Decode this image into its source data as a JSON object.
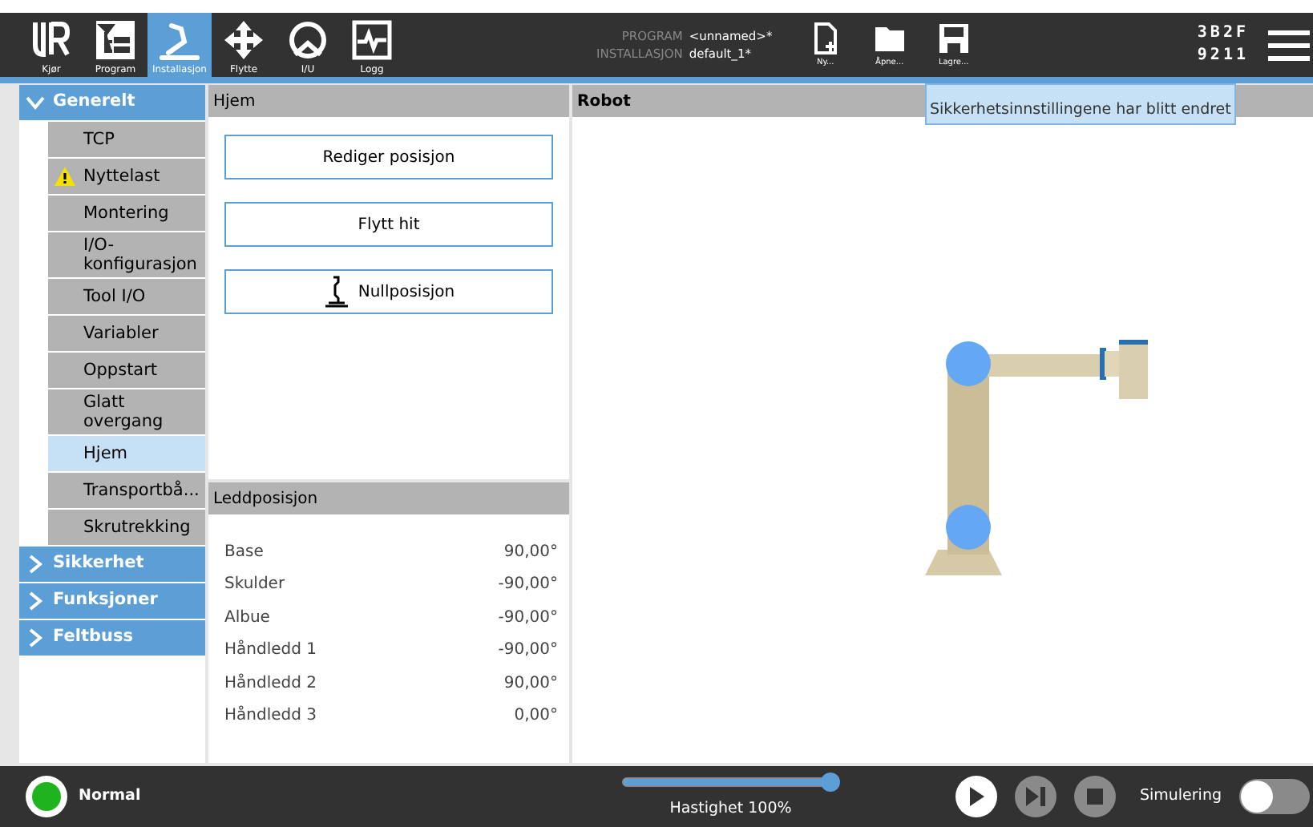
{
  "toolbar": {
    "tabs": [
      {
        "label": "Kjør",
        "kind": "logo",
        "selected": false
      },
      {
        "label": "Program",
        "kind": "program",
        "selected": false
      },
      {
        "label": "Installasjon",
        "kind": "arm",
        "selected": true
      },
      {
        "label": "Flytte",
        "kind": "move",
        "selected": false
      },
      {
        "label": "I/U",
        "kind": "io",
        "selected": false
      },
      {
        "label": "Logg",
        "kind": "log",
        "selected": false
      }
    ],
    "program_label": "PROGRAM",
    "program_value": "<unnamed>*",
    "installation_label": "INSTALLASJON",
    "installation_value": "default_1*",
    "file_buttons": [
      {
        "label": "Ny...",
        "kind": "new"
      },
      {
        "label": "Åpne...",
        "kind": "open"
      },
      {
        "label": "Lagre...",
        "kind": "save"
      }
    ],
    "codes": [
      "3B2F",
      "9211"
    ]
  },
  "tooltip": "Sikkerhetsinnstillingene har blitt endret",
  "sidebar": {
    "groups": [
      {
        "label": "Generelt",
        "expanded": true,
        "items": [
          {
            "label": "TCP",
            "warning": false,
            "selected": false
          },
          {
            "label": "Nyttelast",
            "warning": true,
            "selected": false
          },
          {
            "label": "Montering",
            "warning": false,
            "selected": false
          },
          {
            "label": "I/O-\nkonfigurasjon",
            "warning": false,
            "selected": false
          },
          {
            "label": "Tool I/O",
            "warning": false,
            "selected": false
          },
          {
            "label": "Variabler",
            "warning": false,
            "selected": false
          },
          {
            "label": "Oppstart",
            "warning": false,
            "selected": false
          },
          {
            "label": "Glatt\novergang",
            "warning": false,
            "selected": false
          },
          {
            "label": "Hjem",
            "warning": false,
            "selected": true
          },
          {
            "label": "Transportbå...",
            "warning": false,
            "selected": false
          },
          {
            "label": "Skrutrekking",
            "warning": false,
            "selected": false
          }
        ]
      },
      {
        "label": "Sikkerhet",
        "expanded": false
      },
      {
        "label": "Funksjoner",
        "expanded": false
      },
      {
        "label": "Feltbuss",
        "expanded": false
      }
    ]
  },
  "home_panel": {
    "title": "Hjem",
    "buttons": [
      {
        "label": "Rediger posisjon",
        "kind": "text"
      },
      {
        "label": "Flytt hit",
        "kind": "text"
      },
      {
        "label": "Nullposisjon",
        "kind": "robot"
      }
    ]
  },
  "joint_panel": {
    "title": "Leddposisjon",
    "rows": [
      {
        "name": "Base",
        "value": "90,00°"
      },
      {
        "name": "Skulder",
        "value": "-90,00°"
      },
      {
        "name": "Albue",
        "value": "-90,00°"
      },
      {
        "name": "Håndledd 1",
        "value": "-90,00°"
      },
      {
        "name": "Håndledd 2",
        "value": "90,00°"
      },
      {
        "name": "Håndledd 3",
        "value": "0,00°"
      }
    ]
  },
  "robot_panel": {
    "title": "Robot"
  },
  "status_bar": {
    "status": "Normal",
    "speed": {
      "level": 1,
      "reading": "Hastighet 100%"
    },
    "simulation": {
      "label": "Simulering",
      "on": false
    }
  }
}
